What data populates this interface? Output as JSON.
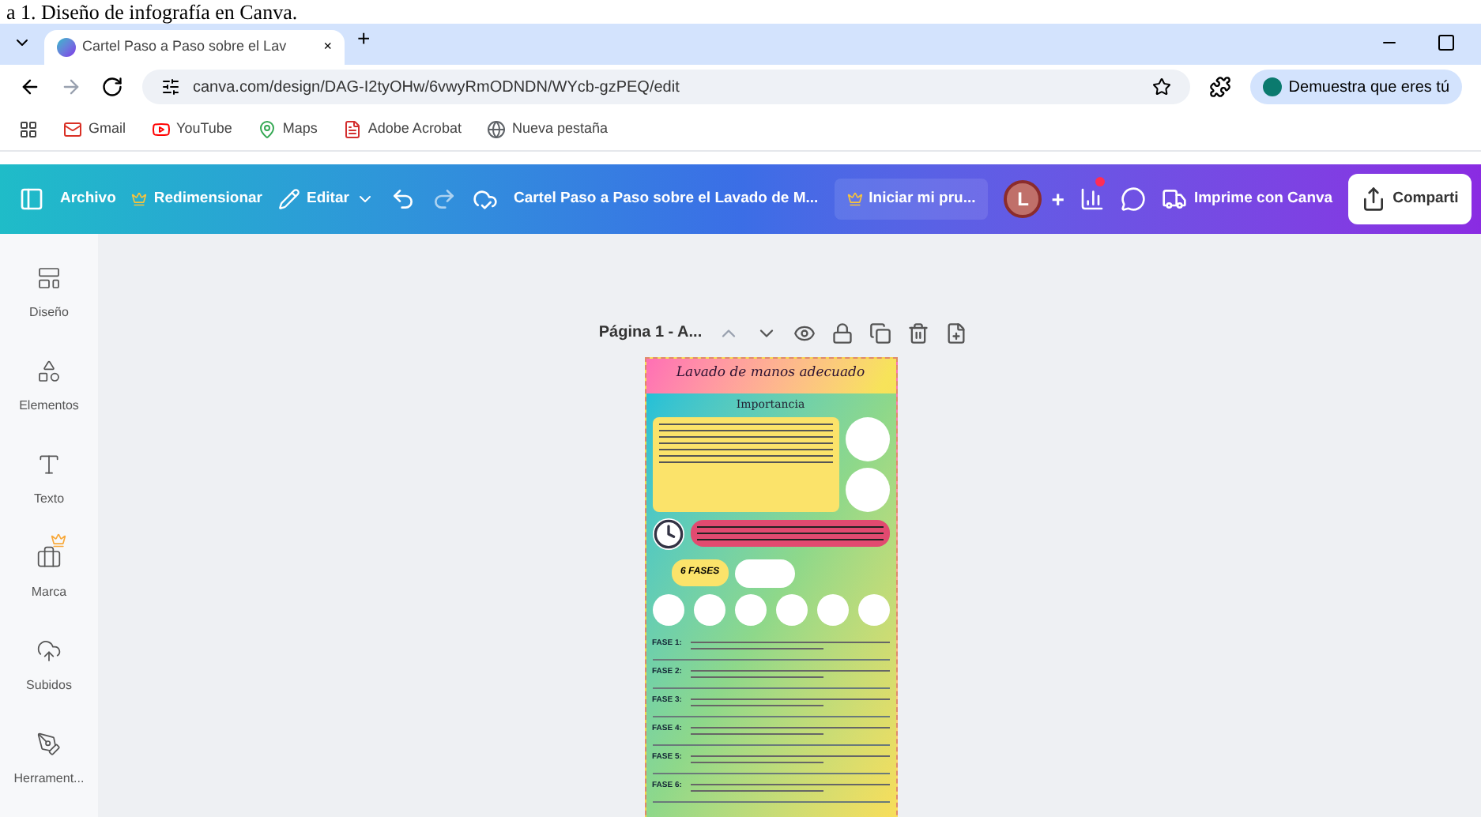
{
  "document_heading": "a 1. Diseño de infografía en Canva.",
  "browser": {
    "tab": {
      "title": "Cartel Paso a Paso sobre el Lav",
      "close": "×"
    },
    "new_tab": "+",
    "address": "canva.com/design/DAG-I2tyOHw/6vwyRmODNDN/WYcb-gzPEQ/edit",
    "profile": "Demuestra que eres tú",
    "bookmarks": [
      "Gmail",
      "YouTube",
      "Maps",
      "Adobe Acrobat",
      "Nueva pestaña"
    ]
  },
  "toolbar": {
    "file": "Archivo",
    "resize": "Redimensionar",
    "edit": "Editar",
    "design_title": "Cartel Paso a Paso sobre el Lavado de M...",
    "trial": "Iniciar mi pru...",
    "avatar": "L",
    "add": "+",
    "print": "Imprime con Canva",
    "share": "Comparti"
  },
  "sidebar": [
    {
      "label": "Diseño",
      "premium": false
    },
    {
      "label": "Elementos",
      "premium": false
    },
    {
      "label": "Texto",
      "premium": false
    },
    {
      "label": "Marca",
      "premium": true
    },
    {
      "label": "Subidos",
      "premium": false
    },
    {
      "label": "Herrament...",
      "premium": false
    }
  ],
  "page": {
    "label": "Página 1 - A..."
  },
  "poster": {
    "title": "Lavado de manos adecuado",
    "subtitle": "Importancia",
    "badge": "6 FASES",
    "phases": [
      "FASE 1:",
      "FASE 2:",
      "FASE 3:",
      "FASE 4:",
      "FASE 5:",
      "FASE 6:"
    ]
  }
}
